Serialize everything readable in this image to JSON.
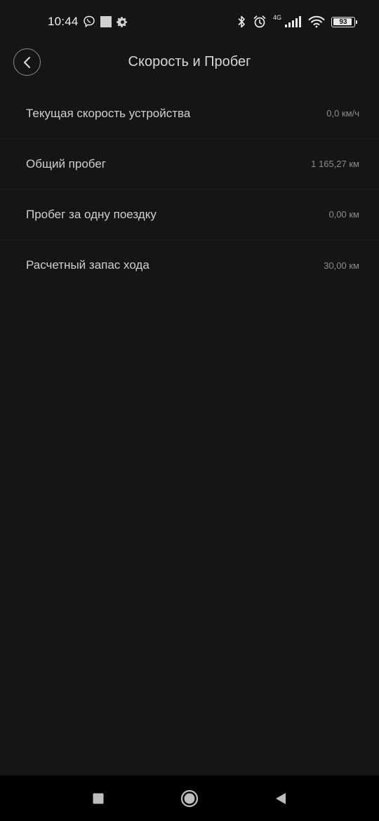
{
  "status_bar": {
    "time": "10:44",
    "network_type": "4G",
    "battery_level": "93",
    "battery_fraction": 0.93,
    "icons": [
      "viber-icon",
      "notification-square-icon",
      "gear-icon",
      "bluetooth-icon",
      "alarm-icon",
      "signal-icon",
      "wifi-icon",
      "battery-icon"
    ]
  },
  "header": {
    "title": "Скорость и Пробег",
    "back_icon": "chevron-left-icon"
  },
  "items": [
    {
      "label": "Текущая скорость устройства",
      "value": "0,0 км/ч"
    },
    {
      "label": "Общий пробег",
      "value": "1 165,27 км"
    },
    {
      "label": "Пробег за одну поездку",
      "value": "0,00 км"
    },
    {
      "label": "Расчетный запас хода",
      "value": "30,00 км"
    }
  ],
  "nav_bar": {
    "buttons": [
      "recents-square-icon",
      "home-circle-icon",
      "back-triangle-icon"
    ]
  },
  "colors": {
    "background": "#151515",
    "text_primary": "#cfcfcf",
    "text_secondary": "#8c8c8c",
    "nav_background": "#000000"
  }
}
